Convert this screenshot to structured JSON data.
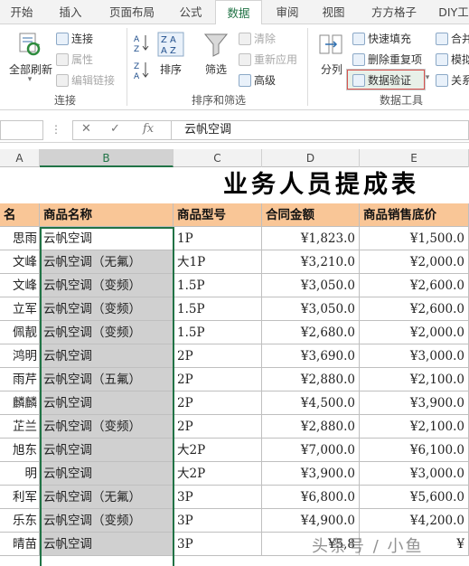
{
  "ribbon_tabs": [
    "开始",
    "插入",
    "页面布局",
    "公式",
    "数据",
    "审阅",
    "视图",
    "方方格子",
    "DIY工"
  ],
  "active_tab": "数据",
  "ribbon": {
    "connections_group": {
      "refresh_all": "全部刷新",
      "connections": "连接",
      "properties": "属性",
      "edit_links": "编辑链接",
      "label": "连接"
    },
    "sort_filter_group": {
      "sort": "排序",
      "filter": "筛选",
      "clear": "清除",
      "reapply": "重新应用",
      "advanced": "高级",
      "label": "排序和筛选"
    },
    "data_tools_group": {
      "text_to_columns": "分列",
      "flash_fill": "快速填充",
      "remove_duplicates": "删除重复项",
      "data_validation": "数据验证",
      "consolidate": "合并",
      "what_if": "模拟",
      "relationships": "关系",
      "label": "数据工具"
    }
  },
  "formula_bar": {
    "fx": "fx",
    "content": "云帆空调"
  },
  "columns": [
    "A",
    "B",
    "C",
    "D",
    "E"
  ],
  "selected_column": "B",
  "sheet_title": "业务人员提成表",
  "table_headers": [
    "名",
    "商品名称",
    "商品型号",
    "合同金额",
    "商品销售底价"
  ],
  "rows": [
    {
      "name": "思雨",
      "product": "云帆空调",
      "model": "1P",
      "amount": "¥1,823.0",
      "price": "¥1,500.0"
    },
    {
      "name": "文峰",
      "product": "云帆空调（无氟）",
      "model": "大1P",
      "amount": "¥3,210.0",
      "price": "¥2,000.0"
    },
    {
      "name": "文峰",
      "product": "云帆空调（变频）",
      "model": "1.5P",
      "amount": "¥3,050.0",
      "price": "¥2,600.0"
    },
    {
      "name": "立军",
      "product": "云帆空调（变频）",
      "model": "1.5P",
      "amount": "¥3,050.0",
      "price": "¥2,600.0"
    },
    {
      "name": "佩靓",
      "product": "云帆空调（变频）",
      "model": "1.5P",
      "amount": "¥2,680.0",
      "price": "¥2,000.0"
    },
    {
      "name": "鸿明",
      "product": "云帆空调",
      "model": "2P",
      "amount": "¥3,690.0",
      "price": "¥3,000.0"
    },
    {
      "name": "雨芹",
      "product": "云帆空调（五氟）",
      "model": "2P",
      "amount": "¥2,880.0",
      "price": "¥2,100.0"
    },
    {
      "name": "麟麟",
      "product": "云帆空调",
      "model": "2P",
      "amount": "¥4,500.0",
      "price": "¥3,900.0"
    },
    {
      "name": "芷兰",
      "product": "云帆空调（变频）",
      "model": "2P",
      "amount": "¥2,880.0",
      "price": "¥2,100.0"
    },
    {
      "name": "旭东",
      "product": "云帆空调",
      "model": "大2P",
      "amount": "¥7,000.0",
      "price": "¥6,100.0"
    },
    {
      "name": "明",
      "product": "云帆空调",
      "model": "大2P",
      "amount": "¥3,900.0",
      "price": "¥3,000.0"
    },
    {
      "name": "利军",
      "product": "云帆空调（无氟）",
      "model": "3P",
      "amount": "¥6,800.0",
      "price": "¥5,600.0"
    },
    {
      "name": "乐东",
      "product": "云帆空调（变频）",
      "model": "3P",
      "amount": "¥4,900.0",
      "price": "¥4,200.0"
    },
    {
      "name": "晴苗",
      "product": "云帆空调",
      "model": "3P",
      "amount": "¥5,8",
      "price": "¥"
    }
  ],
  "watermark": "头条号 / 小鱼",
  "colors": {
    "accent": "#217346",
    "header_fill": "#f9c697",
    "selection_fill": "#d0d0d0",
    "highlight_border": "#d9534f"
  }
}
